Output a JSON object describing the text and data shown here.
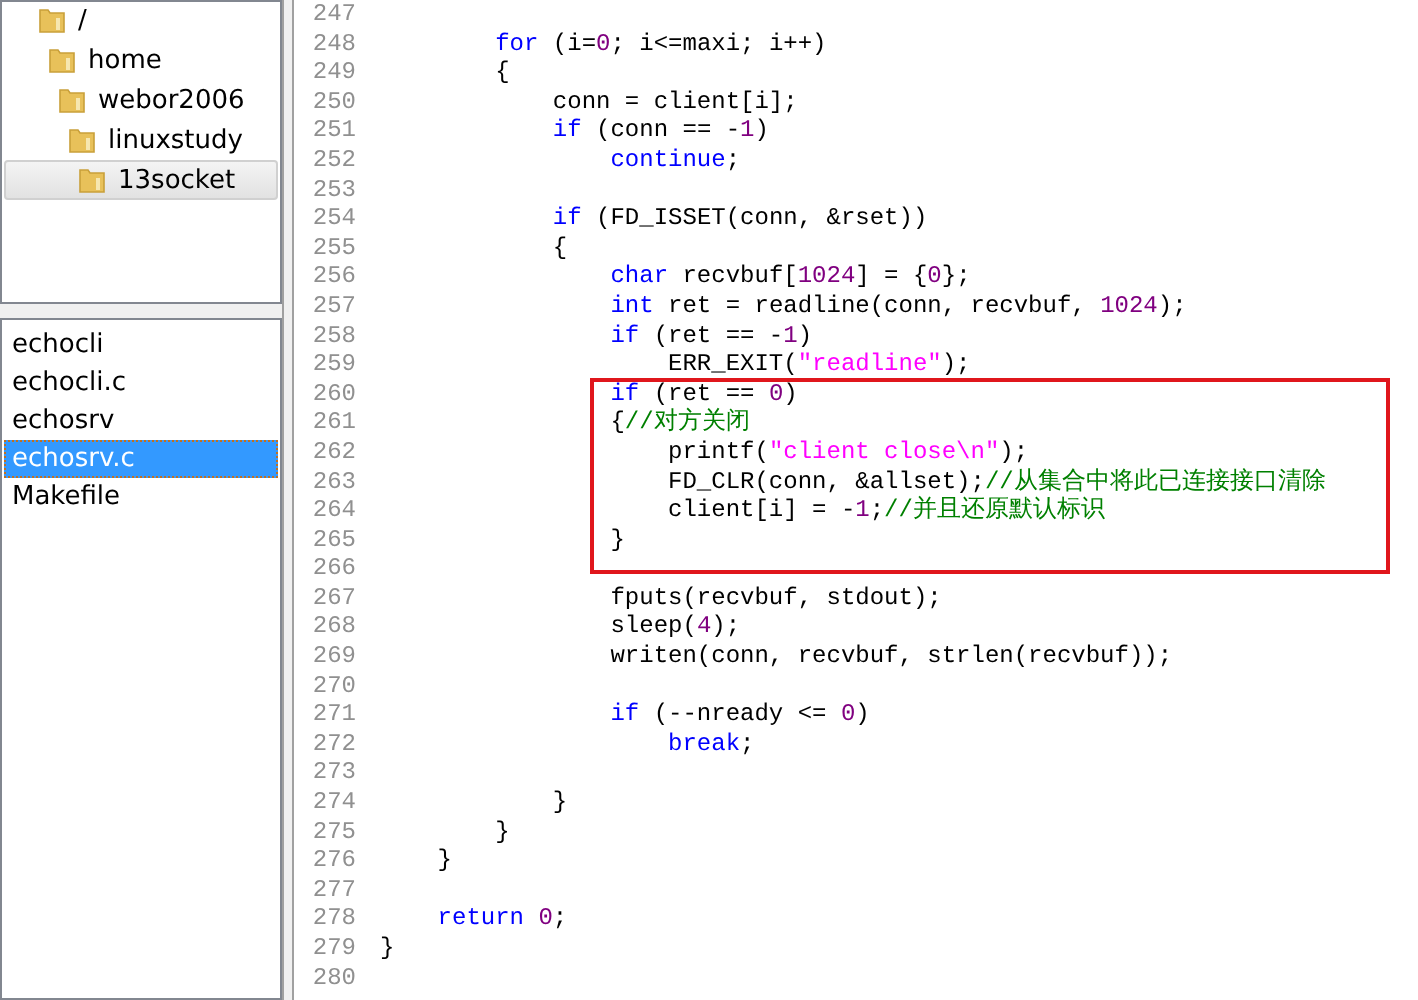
{
  "folder_tree": [
    {
      "label": "/",
      "selected": false,
      "children": [
        {
          "label": "home",
          "selected": false,
          "children": [
            {
              "label": "webor2006",
              "selected": false,
              "children": [
                {
                  "label": "linuxstudy",
                  "selected": false,
                  "children": [
                    {
                      "label": "13socket",
                      "selected": true
                    }
                  ]
                }
              ]
            }
          ]
        }
      ]
    }
  ],
  "files": [
    {
      "label": "echocli",
      "selected": false
    },
    {
      "label": "echocli.c",
      "selected": false
    },
    {
      "label": "echosrv",
      "selected": false
    },
    {
      "label": "echosrv.c",
      "selected": true
    },
    {
      "label": "Makefile",
      "selected": false
    }
  ],
  "code_blocks": [
    {
      "framed": false,
      "lines": [
        {
          "number": "247"
        },
        {
          "number": "248",
          "tokens": [
            {
              "kind": "keyword",
              "text": "        for"
            },
            {
              "kind": "plain",
              "text": " (i="
            },
            {
              "kind": "number",
              "text": "0"
            },
            {
              "kind": "plain",
              "text": "; i<=maxi; i++)"
            }
          ]
        },
        {
          "number": "249",
          "tokens": [
            {
              "kind": "plain",
              "text": "        {"
            }
          ]
        },
        {
          "number": "250",
          "tokens": [
            {
              "kind": "plain",
              "text": "            conn = client[i];"
            }
          ]
        },
        {
          "number": "251",
          "tokens": [
            {
              "kind": "keyword",
              "text": "            if"
            },
            {
              "kind": "plain",
              "text": " (conn == -"
            },
            {
              "kind": "number",
              "text": "1"
            },
            {
              "kind": "plain",
              "text": ")"
            }
          ]
        },
        {
          "number": "252",
          "tokens": [
            {
              "kind": "keyword",
              "text": "                continue"
            },
            {
              "kind": "plain",
              "text": ";"
            }
          ]
        },
        {
          "number": "253"
        },
        {
          "number": "254",
          "tokens": [
            {
              "kind": "keyword",
              "text": "            if"
            },
            {
              "kind": "plain",
              "text": " (FD_ISSET(conn, &rset))"
            }
          ]
        },
        {
          "number": "255",
          "tokens": [
            {
              "kind": "plain",
              "text": "            {"
            }
          ]
        },
        {
          "number": "256",
          "tokens": [
            {
              "kind": "keyword",
              "text": "                char"
            },
            {
              "kind": "plain",
              "text": " recvbuf["
            },
            {
              "kind": "number",
              "text": "1024"
            },
            {
              "kind": "plain",
              "text": "] = {"
            },
            {
              "kind": "number",
              "text": "0"
            },
            {
              "kind": "plain",
              "text": "};"
            }
          ]
        },
        {
          "number": "257",
          "tokens": [
            {
              "kind": "keyword",
              "text": "                int"
            },
            {
              "kind": "plain",
              "text": " ret = readline(conn, recvbuf, "
            },
            {
              "kind": "number",
              "text": "1024"
            },
            {
              "kind": "plain",
              "text": ");"
            }
          ]
        },
        {
          "number": "258",
          "tokens": [
            {
              "kind": "keyword",
              "text": "                if"
            },
            {
              "kind": "plain",
              "text": " (ret == -"
            },
            {
              "kind": "number",
              "text": "1"
            },
            {
              "kind": "plain",
              "text": ")"
            }
          ]
        },
        {
          "number": "259",
          "tokens": [
            {
              "kind": "plain",
              "text": "                    ERR_EXIT("
            },
            {
              "kind": "string",
              "text": "\"readline\""
            },
            {
              "kind": "plain",
              "text": ");"
            }
          ]
        }
      ]
    },
    {
      "framed": true,
      "lines": [
        {
          "number": "260",
          "tokens": [
            {
              "kind": "keyword",
              "text": "                if"
            },
            {
              "kind": "plain",
              "text": " (ret == "
            },
            {
              "kind": "number",
              "text": "0"
            },
            {
              "kind": "plain",
              "text": ")"
            }
          ]
        },
        {
          "number": "261",
          "tokens": [
            {
              "kind": "plain",
              "text": "                {"
            },
            {
              "kind": "comment",
              "text": "//对方关闭"
            }
          ]
        },
        {
          "number": "262",
          "tokens": [
            {
              "kind": "plain",
              "text": "                    printf("
            },
            {
              "kind": "string",
              "text": "\"client close\\n\""
            },
            {
              "kind": "plain",
              "text": ");"
            }
          ]
        },
        {
          "number": "263",
          "tokens": [
            {
              "kind": "plain",
              "text": "                    FD_CLR(conn, &allset);"
            },
            {
              "kind": "comment",
              "text": "//从集合中将此已连接接口清除"
            }
          ]
        },
        {
          "number": "264",
          "tokens": [
            {
              "kind": "plain",
              "text": "                    client[i] = -"
            },
            {
              "kind": "number",
              "text": "1"
            },
            {
              "kind": "plain",
              "text": ";"
            },
            {
              "kind": "comment",
              "text": "//并且还原默认标识"
            }
          ]
        },
        {
          "number": "265",
          "tokens": [
            {
              "kind": "plain",
              "text": "                }"
            }
          ]
        },
        {
          "number": "266"
        }
      ]
    },
    {
      "framed": false,
      "lines": [
        {
          "number": "267",
          "tokens": [
            {
              "kind": "plain",
              "text": "                fputs(recvbuf, stdout);"
            }
          ]
        },
        {
          "number": "268",
          "tokens": [
            {
              "kind": "plain",
              "text": "                sleep("
            },
            {
              "kind": "number",
              "text": "4"
            },
            {
              "kind": "plain",
              "text": ");"
            }
          ]
        },
        {
          "number": "269",
          "tokens": [
            {
              "kind": "plain",
              "text": "                writen(conn, recvbuf, strlen(recvbuf));"
            }
          ]
        },
        {
          "number": "270"
        },
        {
          "number": "271",
          "tokens": [
            {
              "kind": "keyword",
              "text": "                if"
            },
            {
              "kind": "plain",
              "text": " (--nready <= "
            },
            {
              "kind": "number",
              "text": "0"
            },
            {
              "kind": "plain",
              "text": ")"
            }
          ]
        },
        {
          "number": "272",
          "tokens": [
            {
              "kind": "keyword",
              "text": "                    break"
            },
            {
              "kind": "plain",
              "text": ";"
            }
          ]
        },
        {
          "number": "273"
        },
        {
          "number": "274",
          "tokens": [
            {
              "kind": "plain",
              "text": "            }"
            }
          ]
        },
        {
          "number": "275",
          "tokens": [
            {
              "kind": "plain",
              "text": "        }"
            }
          ]
        },
        {
          "number": "276",
          "tokens": [
            {
              "kind": "plain",
              "text": "    }"
            }
          ]
        },
        {
          "number": "277"
        },
        {
          "number": "278",
          "tokens": [
            {
              "kind": "keyword",
              "text": "    return"
            },
            {
              "kind": "number",
              "text": " 0"
            },
            {
              "kind": "plain",
              "text": ";"
            }
          ]
        },
        {
          "number": "279",
          "tokens": [
            {
              "kind": "plain",
              "text": "}"
            }
          ]
        },
        {
          "number": "280"
        }
      ]
    }
  ]
}
